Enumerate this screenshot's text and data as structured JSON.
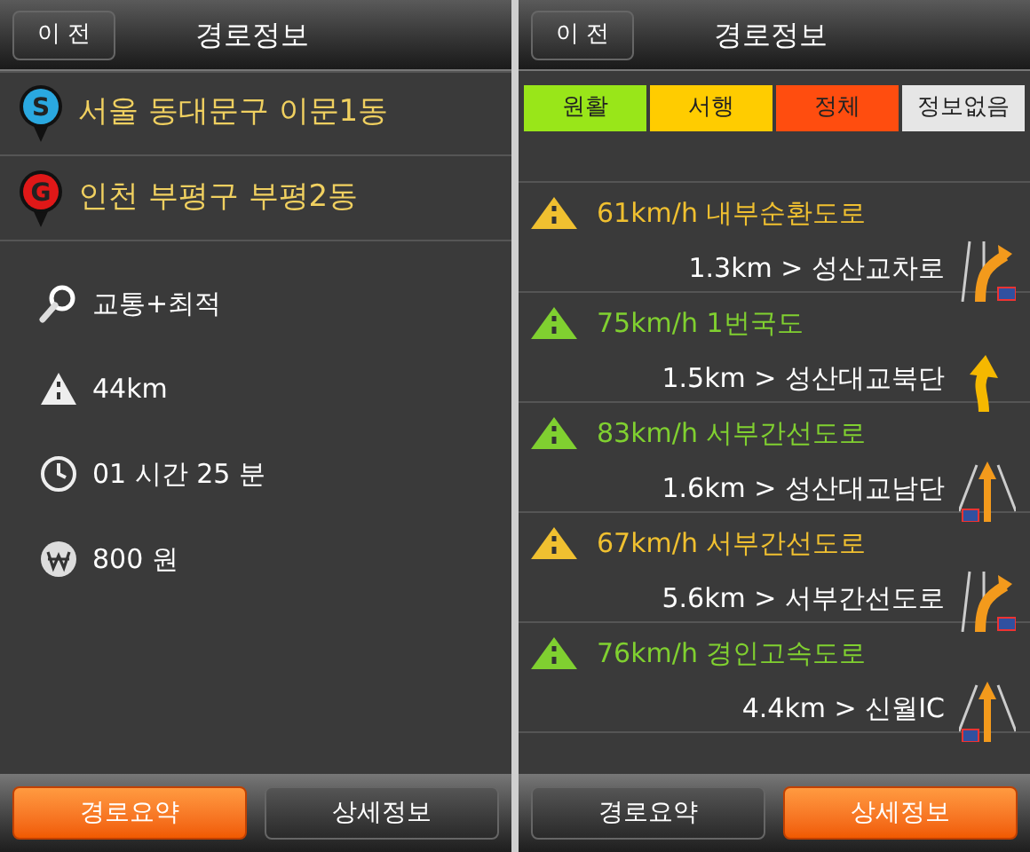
{
  "summary_screen": {
    "back_button": "이 전",
    "title": "경로정보",
    "origin": {
      "badge": "S",
      "label": "서울 동대문구 이문1동"
    },
    "destination": {
      "badge": "G",
      "label": "인천 부평구 부평2동"
    },
    "details": [
      {
        "kind": "search",
        "text": "교통+최적"
      },
      {
        "kind": "distance",
        "text": "44km"
      },
      {
        "kind": "time",
        "text": "01 시간 25 분"
      },
      {
        "kind": "fare",
        "text": "800 원"
      }
    ],
    "bottom_tabs": [
      {
        "label": "경로요약",
        "selected": true
      },
      {
        "label": "상세정보",
        "selected": false
      }
    ]
  },
  "detail_screen": {
    "back_button": "이 전",
    "title": "경로정보",
    "legend": [
      {
        "label": "원활",
        "color": "#99e619"
      },
      {
        "label": "서행",
        "color": "#ffcc00"
      },
      {
        "label": "정체",
        "color": "#ff4d0f"
      },
      {
        "label": "정보없음",
        "color": "#e6e6e6"
      }
    ],
    "segments": [
      {
        "speed_road": "61km/h 내부순환도로",
        "next": "1.3km > 성산교차로",
        "color": "#f0c030",
        "kind": "ramp"
      },
      {
        "speed_road": "75km/h 1번국도",
        "next": "1.5km > 성산대교북단",
        "color": "#80d030",
        "kind": "arrow"
      },
      {
        "speed_road": "83km/h 서부간선도로",
        "next": "1.6km > 성산대교남단",
        "color": "#80d030",
        "kind": "straight"
      },
      {
        "speed_road": "67km/h 서부간선도로",
        "next": "5.6km > 서부간선도로",
        "color": "#f0c030",
        "kind": "ramp"
      },
      {
        "speed_road": "76km/h 경인고속도로",
        "next": "4.4km > 신월IC",
        "color": "#80d030",
        "kind": "straight"
      }
    ],
    "bottom_tabs": [
      {
        "label": "경로요약",
        "selected": false
      },
      {
        "label": "상세정보",
        "selected": true
      }
    ]
  }
}
